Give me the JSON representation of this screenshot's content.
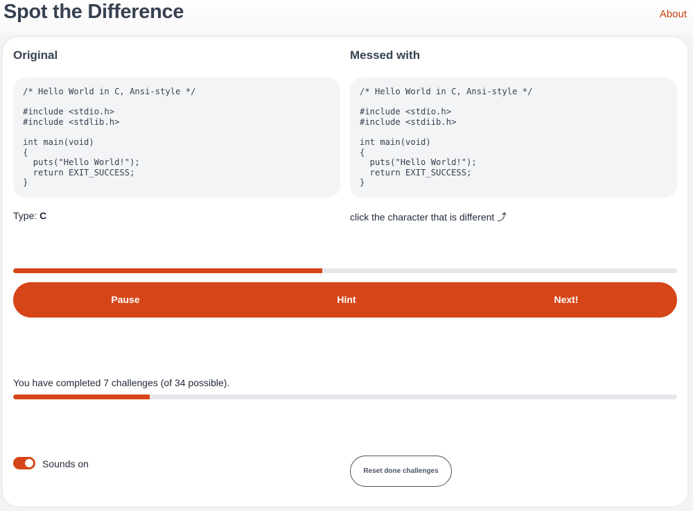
{
  "header": {
    "title": "Spot the Difference",
    "about_link": "About"
  },
  "original": {
    "title": "Original",
    "code": "/* Hello World in C, Ansi-style */\n\n#include <stdio.h>\n#include <stdlib.h>\n\nint main(void)\n{\n  puts(\"Hello World!\");\n  return EXIT_SUCCESS;\n}"
  },
  "messed": {
    "title": "Messed with",
    "code": "/* Hello World in C, Ansi-style */\n\n#include <stdio.h>\n#include <stdiib.h>\n\nint main(void)\n{\n  puts(\"Hello World!\");\n  return EXIT_SUCCESS;\n}"
  },
  "type_info": {
    "label": "Type: ",
    "value": "C"
  },
  "instruction": "click the character that is different ⤴",
  "timer_progress": 0.466,
  "actions": {
    "pause": "Pause",
    "hint": "Hint",
    "next": "Next!"
  },
  "completion": {
    "text": "You have completed 7 challenges (of 34 possible).",
    "completed": 7,
    "total": 34
  },
  "sounds": {
    "label": "Sounds on",
    "enabled": true
  },
  "reset_button": "Reset done challenges",
  "colors": {
    "accent": "#d64518",
    "link": "#c2410c",
    "track": "#e5e7eb"
  }
}
